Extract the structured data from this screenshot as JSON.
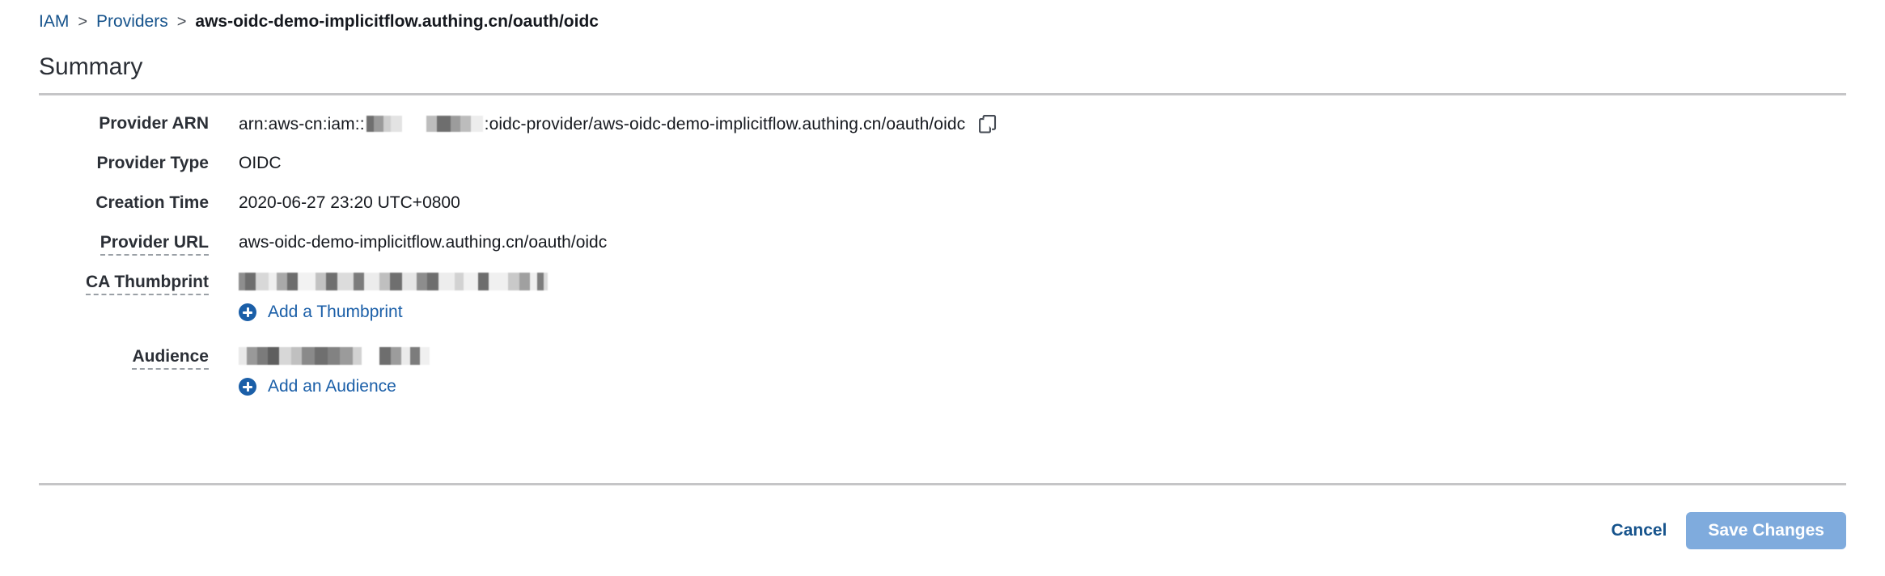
{
  "breadcrumb": {
    "items": [
      {
        "label": "IAM",
        "type": "link"
      },
      {
        "label": "Providers",
        "type": "link"
      },
      {
        "label": "aws-oidc-demo-implicitflow.authing.cn/oauth/oidc",
        "type": "current"
      }
    ],
    "separator": ">"
  },
  "page_title": "Summary",
  "details": {
    "provider_arn": {
      "label": "Provider ARN",
      "prefix": "arn:aws-cn:iam::",
      "suffix": ":oidc-provider/aws-oidc-demo-implicitflow.authing.cn/oauth/oidc",
      "redacted": true,
      "copy_icon": "copy-icon"
    },
    "provider_type": {
      "label": "Provider Type",
      "value": "OIDC"
    },
    "creation_time": {
      "label": "Creation Time",
      "value": "2020-06-27 23:20 UTC+0800"
    },
    "provider_url": {
      "label": "Provider URL",
      "value": "aws-oidc-demo-implicitflow.authing.cn/oauth/oidc",
      "has_tooltip": true
    },
    "ca_thumbprint": {
      "label": "CA Thumbprint",
      "value": "",
      "redacted": true,
      "has_tooltip": true,
      "add_link": "Add a Thumbprint",
      "add_icon": "plus-circle-icon"
    },
    "audience": {
      "label": "Audience",
      "value": "",
      "redacted": true,
      "has_tooltip": true,
      "add_link": "Add an Audience",
      "add_icon": "plus-circle-icon"
    }
  },
  "footer": {
    "cancel_label": "Cancel",
    "save_label": "Save Changes"
  },
  "colors": {
    "link": "#16538c",
    "add_link": "#1b5fa8",
    "text": "#16191f",
    "label": "#2b2f36",
    "rule": "#c5c5c7",
    "save_button": "#7fabdd",
    "save_button_text": "#ffffff",
    "background": "#ffffff"
  }
}
